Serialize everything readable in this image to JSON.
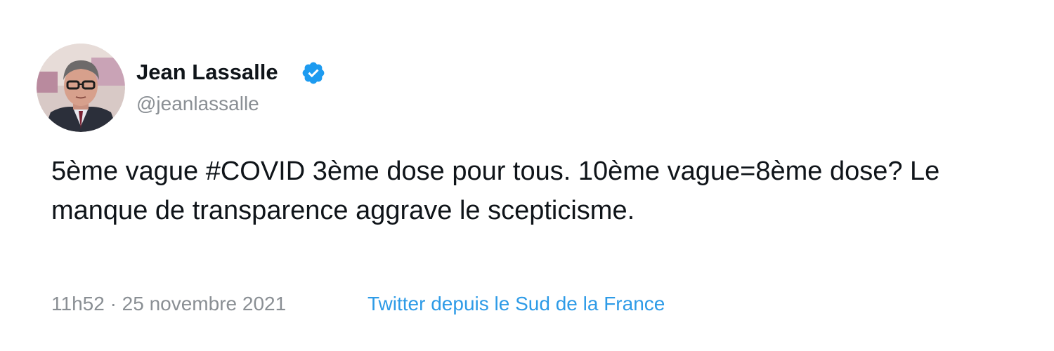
{
  "author": {
    "display_name": "Jean Lassalle",
    "handle": "@jeanlassalle",
    "verified": true,
    "avatar_icon": "avatar-photo"
  },
  "tweet": {
    "text": "5ème vague #COVID 3ème dose pour tous. 10ème vague=8ème dose? Le manque de transparence aggrave le scepticisme.",
    "timestamp": "11h52 · 25 novembre 2021",
    "source": "Twitter depuis le Sud de la France"
  },
  "colors": {
    "text": "#0f1419",
    "secondary": "#8a8f94",
    "link": "#2e9be7",
    "verified_badge": "#1d9bf0"
  }
}
